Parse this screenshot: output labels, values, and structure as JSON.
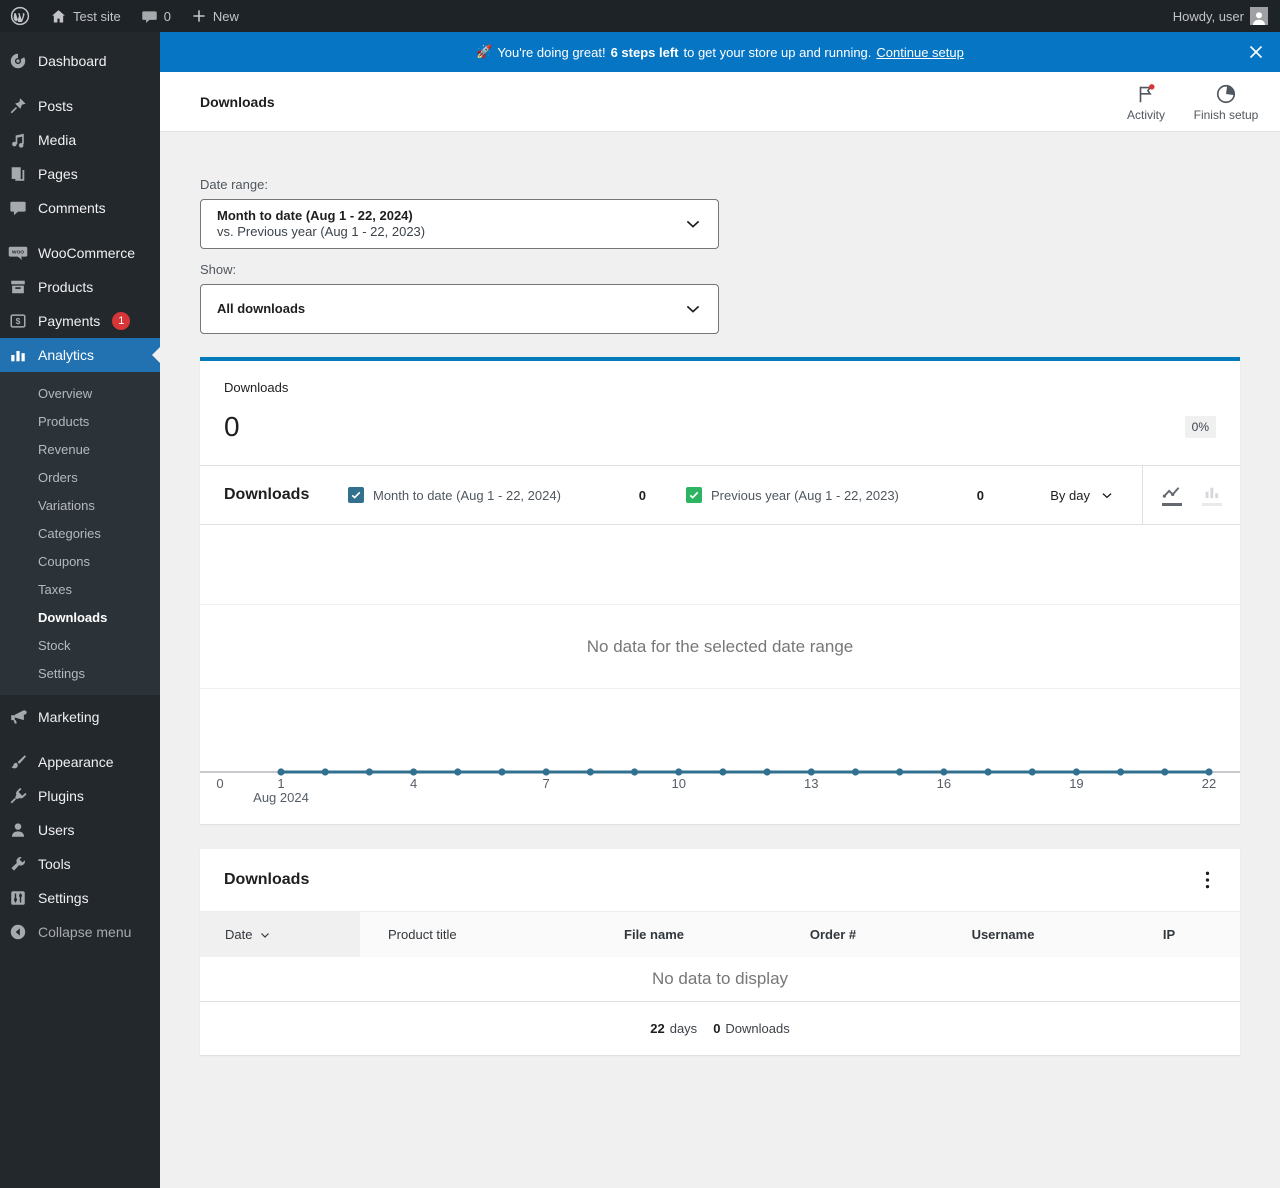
{
  "admin_bar": {
    "site_name": "Test site",
    "comment_count": "0",
    "new_label": "New",
    "howdy": "Howdy, user"
  },
  "banner": {
    "emoji": "🚀",
    "text_prefix": "You're doing great!",
    "steps_bold": "6 steps left",
    "text_suffix": "to get your store up and running.",
    "link_label": "Continue setup"
  },
  "header": {
    "title": "Downloads",
    "activity_label": "Activity",
    "finish_setup_label": "Finish setup"
  },
  "filters": {
    "date_range_label": "Date range:",
    "date_range_value": "Month to date (Aug 1 - 22, 2024)",
    "date_range_compare": "vs. Previous year (Aug 1 - 22, 2023)",
    "show_label": "Show:",
    "show_value": "All downloads"
  },
  "summary_tile": {
    "label": "Downloads",
    "value": "0",
    "delta": "0%"
  },
  "chart": {
    "title": "Downloads",
    "legend": [
      {
        "label": "Month to date (Aug 1 - 22, 2024)",
        "count": "0",
        "color": "#31708f"
      },
      {
        "label": "Previous year (Aug 1 - 22, 2023)",
        "count": "0",
        "color": "#2db463"
      }
    ],
    "interval": "By day",
    "empty_message": "No data for the selected date range"
  },
  "chart_data": {
    "type": "line",
    "title": "Downloads",
    "x": [
      1,
      2,
      3,
      4,
      5,
      6,
      7,
      8,
      9,
      10,
      11,
      12,
      13,
      14,
      15,
      16,
      17,
      18,
      19,
      20,
      21,
      22
    ],
    "x_day_ticks": [
      1,
      4,
      7,
      10,
      13,
      16,
      19,
      22
    ],
    "x_label_month": "Aug 2024",
    "y_ticks": [
      "0"
    ],
    "ylim": [
      0,
      1
    ],
    "series": [
      {
        "name": "Month to date (Aug 1 - 22, 2024)",
        "color": "#31708f",
        "values": [
          0,
          0,
          0,
          0,
          0,
          0,
          0,
          0,
          0,
          0,
          0,
          0,
          0,
          0,
          0,
          0,
          0,
          0,
          0,
          0,
          0,
          0
        ],
        "total": 0
      },
      {
        "name": "Previous year (Aug 1 - 22, 2023)",
        "color": "#2db463",
        "values": [
          0,
          0,
          0,
          0,
          0,
          0,
          0,
          0,
          0,
          0,
          0,
          0,
          0,
          0,
          0,
          0,
          0,
          0,
          0,
          0,
          0,
          0
        ],
        "total": 0
      }
    ],
    "legend_position": "top",
    "grid": false,
    "empty_message": "No data for the selected date range"
  },
  "table": {
    "title": "Downloads",
    "columns": [
      "Date",
      "Product title",
      "File name",
      "Order #",
      "Username",
      "IP"
    ],
    "empty_message": "No data to display",
    "summary": [
      {
        "value": "22",
        "label": "days"
      },
      {
        "value": "0",
        "label": "Downloads"
      }
    ]
  },
  "sidebar": {
    "top": [
      {
        "label": "Dashboard",
        "icon": "dashboard-icon"
      },
      {
        "label": "Posts",
        "icon": "pin-icon"
      },
      {
        "label": "Media",
        "icon": "media-icon"
      },
      {
        "label": "Pages",
        "icon": "pages-icon"
      },
      {
        "label": "Comments",
        "icon": "comments-icon"
      },
      {
        "label": "WooCommerce",
        "icon": "woocommerce-icon"
      },
      {
        "label": "Products",
        "icon": "products-icon"
      },
      {
        "label": "Payments",
        "icon": "payments-icon",
        "badge": "1"
      },
      {
        "label": "Analytics",
        "icon": "analytics-icon"
      }
    ],
    "analytics_submenu": [
      "Overview",
      "Products",
      "Revenue",
      "Orders",
      "Variations",
      "Categories",
      "Coupons",
      "Taxes",
      "Downloads",
      "Stock",
      "Settings"
    ],
    "current_submenu": "Downloads",
    "bottom": [
      {
        "label": "Marketing",
        "icon": "megaphone-icon"
      },
      {
        "label": "Appearance",
        "icon": "brush-icon"
      },
      {
        "label": "Plugins",
        "icon": "plugin-icon"
      },
      {
        "label": "Users",
        "icon": "user-icon"
      },
      {
        "label": "Tools",
        "icon": "wrench-icon"
      },
      {
        "label": "Settings",
        "icon": "sliders-icon"
      },
      {
        "label": "Collapse menu",
        "icon": "collapse-icon"
      }
    ]
  },
  "colors": {
    "accent_blue": "#2271b1",
    "banner_blue": "#0675c4",
    "indicator_blue": "#007cba",
    "series_primary": "#31708f",
    "series_secondary": "#2db463",
    "badge_red": "#d63638"
  }
}
